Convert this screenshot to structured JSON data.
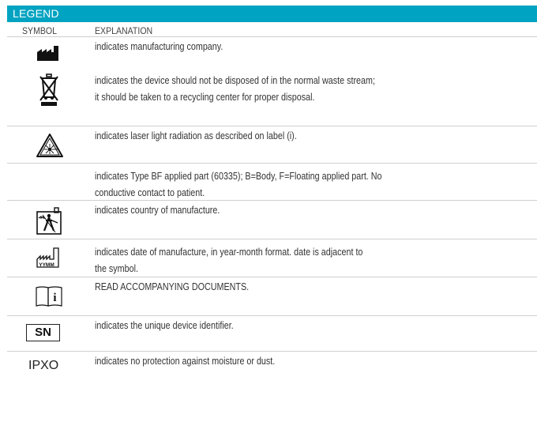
{
  "header": {
    "title": "LEGEND",
    "col_symbol": "SYMBOL",
    "col_explanation": "EXPLANATION"
  },
  "rows": [
    {
      "icon": "factory-icon",
      "line1": "indicates manufacturing company.",
      "line2": ""
    },
    {
      "icon": "crossed-bin-icon",
      "line1": "indicates the device should not be disposed of in the normal waste stream;",
      "line2": "it should be taken to a recycling center for proper disposal."
    },
    {
      "icon": "laser-warning-icon",
      "line1": "indicates laser light radiation as described on label (i).",
      "line2": ""
    },
    {
      "icon": "",
      "line1": "indicates Type BF applied part (60335); B=Body, F=Floating applied part. No",
      "line2": "conductive contact to patient."
    },
    {
      "icon": "country-of-manufacture-icon",
      "line1": "indicates country of manufacture.",
      "line2": ""
    },
    {
      "icon": "date-of-manufacture-icon",
      "line1": "indicates date of manufacture, in year-month format. date is adjacent to",
      "line2": "the symbol.",
      "icon_text": "YYMM"
    },
    {
      "icon": "consult-documents-icon",
      "line1": "READ ACCOMPANYING DOCUMENTS.",
      "line2": "",
      "icon_text": "i"
    },
    {
      "icon": "serial-number-icon",
      "line1": "indicates the unique device identifier.",
      "line2": "",
      "icon_text": "SN"
    },
    {
      "icon": "ip-rating-text",
      "line1": "indicates no protection against moisture or dust.",
      "line2": "",
      "icon_text": "IPXO"
    }
  ],
  "colors": {
    "header_bg": "#00a3c1",
    "rule": "#cfcfcf"
  }
}
